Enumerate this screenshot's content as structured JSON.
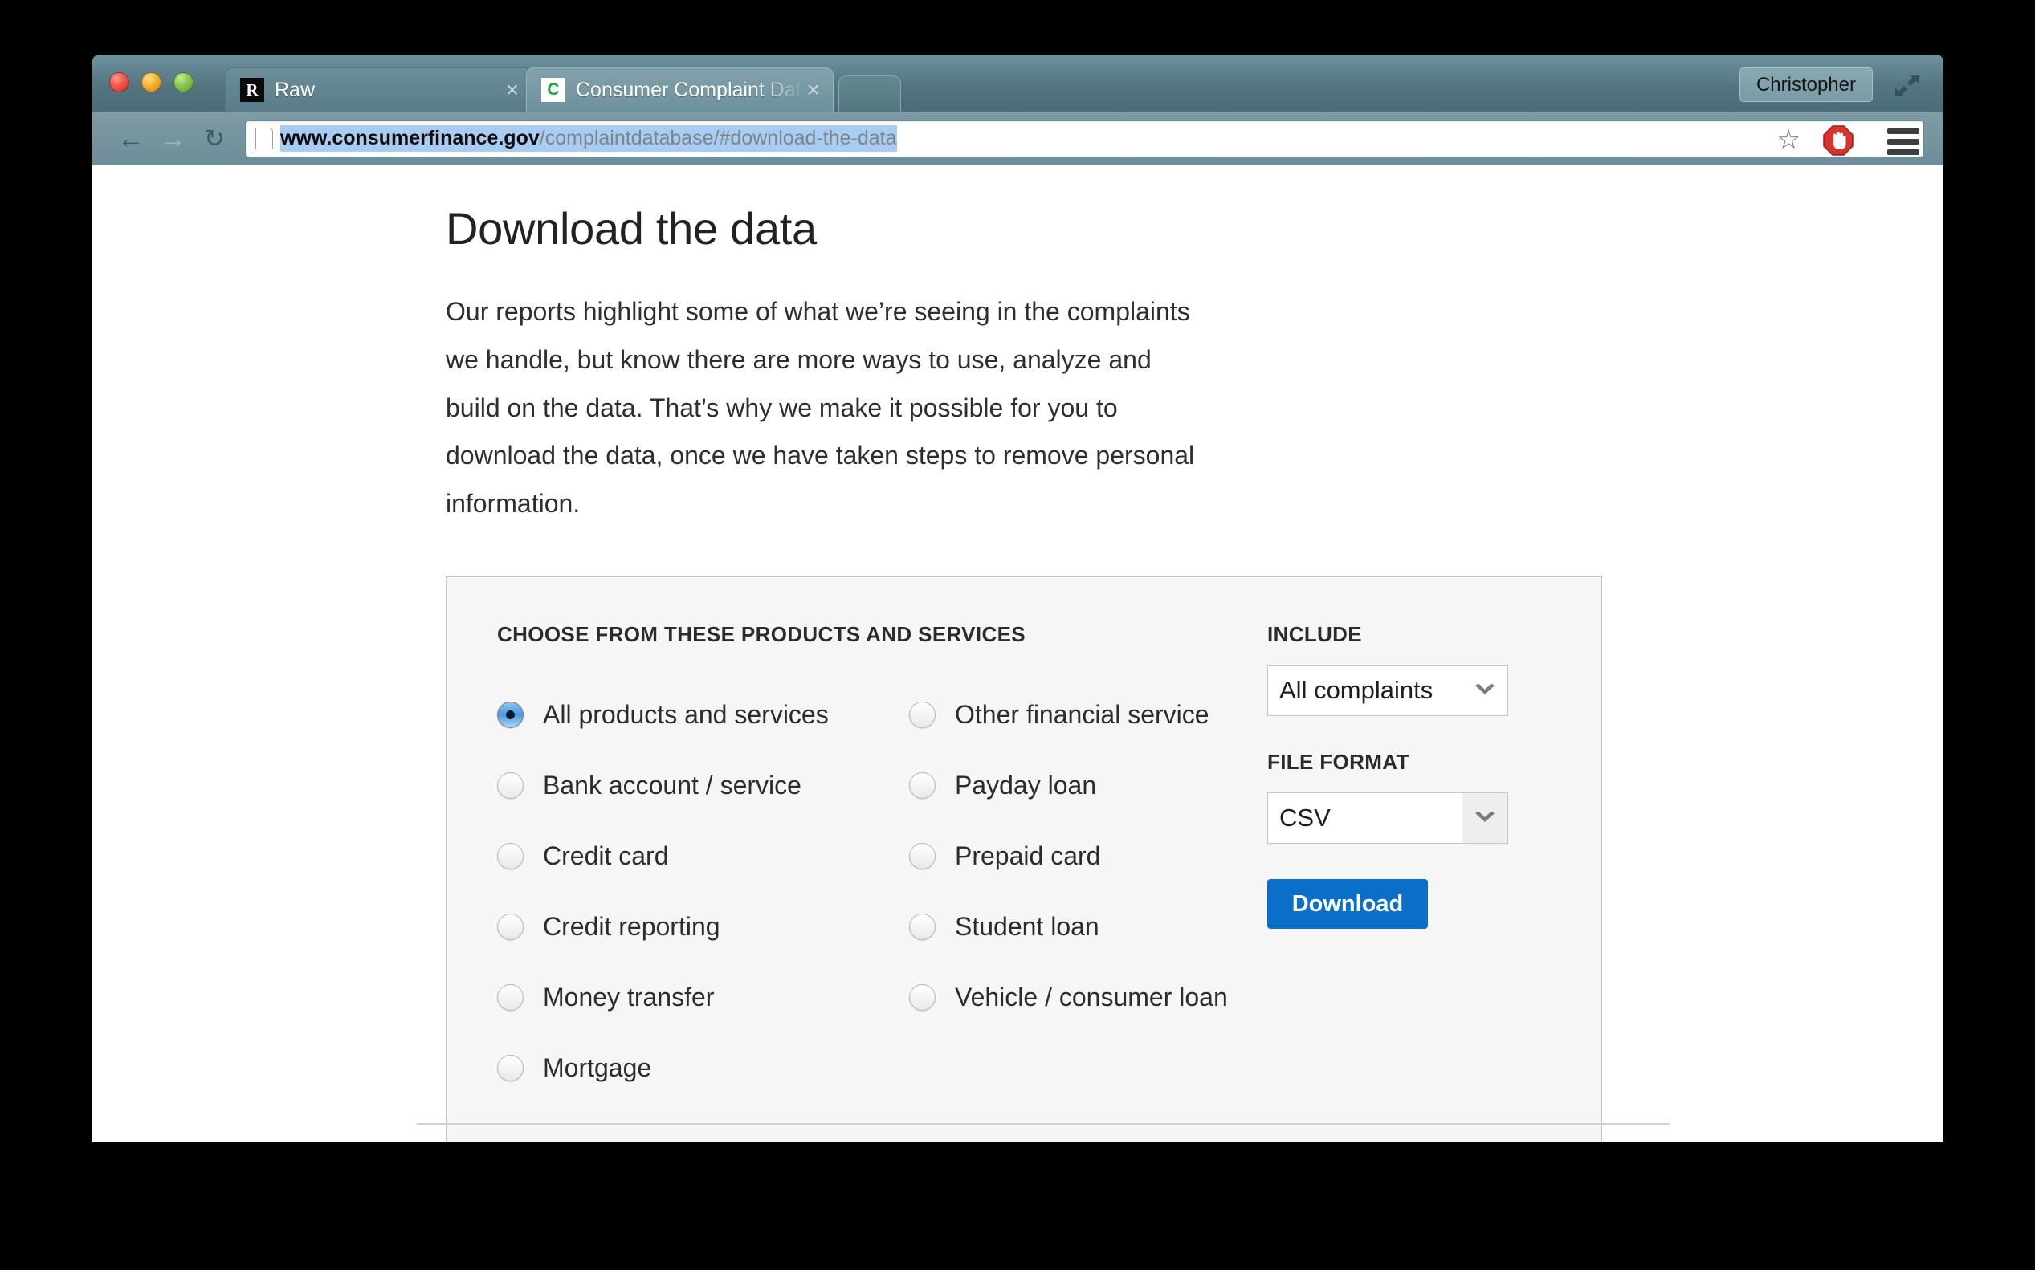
{
  "browser": {
    "traffic_lights": [
      "close",
      "minimize",
      "zoom"
    ],
    "tabs": [
      {
        "favicon_letter": "R",
        "favicon_name": "raw-favicon",
        "title": "Raw",
        "active": false,
        "close_label": "×"
      },
      {
        "favicon_letter": "C",
        "favicon_name": "cfpb-favicon",
        "title": "Consumer Complaint Data",
        "active": true,
        "close_label": "×"
      }
    ],
    "new_tab_label": "",
    "profile_button": "Christopher",
    "expand_icon": "expand-window-icon",
    "nav": {
      "back_icon": "←",
      "forward_icon": "→",
      "reload_icon": "↻"
    },
    "url": {
      "domain": "www.consumerfinance.gov",
      "path": "/complaintdatabase/#download-the-data",
      "page_icon": "page-document-icon",
      "selected": true
    },
    "toolbar_icons": {
      "bookmark": "☆",
      "adblock": "adblock-stop-icon",
      "menu": "hamburger-menu-icon"
    }
  },
  "main": {
    "title": "Download the data",
    "intro": "Our reports highlight some of what we’re seeing in the complaints we handle, but know there are more ways to use, analyze and build on the data. That’s why we make it possible for you to download the data, once we have taken steps to remove personal information."
  },
  "form": {
    "products_label": "CHOOSE FROM THESE PRODUCTS AND SERVICES",
    "products_left": [
      {
        "label": "All products and services",
        "checked": true
      },
      {
        "label": "Bank account / service",
        "checked": false
      },
      {
        "label": "Credit card",
        "checked": false
      },
      {
        "label": "Credit reporting",
        "checked": false
      },
      {
        "label": "Money transfer",
        "checked": false
      },
      {
        "label": "Mortgage",
        "checked": false
      }
    ],
    "products_right": [
      {
        "label": "Other financial service",
        "checked": false
      },
      {
        "label": "Payday loan",
        "checked": false
      },
      {
        "label": "Prepaid card",
        "checked": false
      },
      {
        "label": "Student loan",
        "checked": false
      },
      {
        "label": "Vehicle / consumer loan",
        "checked": false
      }
    ],
    "include_label": "INCLUDE",
    "include_value": "All complaints",
    "file_format_label": "FILE FORMAT",
    "file_format_value": "CSV",
    "dropdown_arrow": "❯",
    "download_label": "Download"
  },
  "colors": {
    "accent_blue": "#0a6fc9",
    "chrome_teal": "#6e8d98",
    "panel_bg": "#f6f6f6",
    "selection_blue": "#a9cdf2"
  }
}
